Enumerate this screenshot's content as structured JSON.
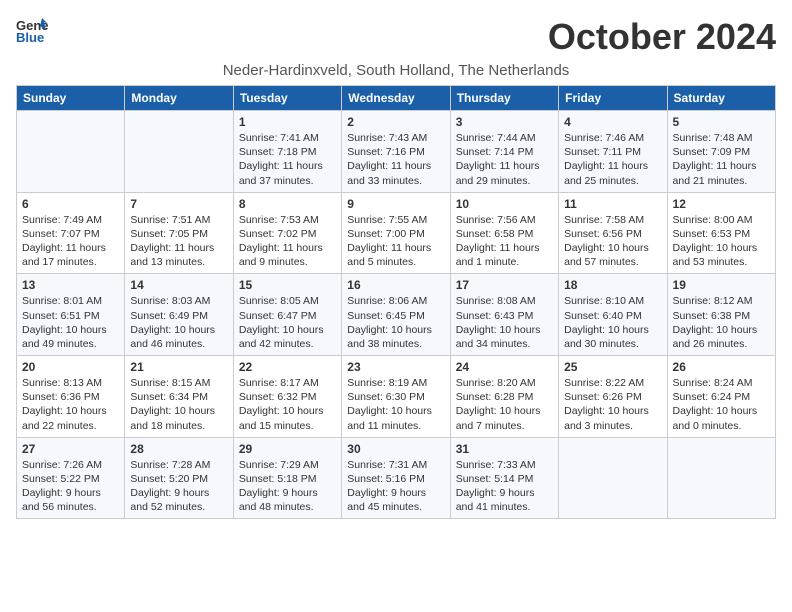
{
  "header": {
    "logo": {
      "general": "General",
      "blue": "Blue"
    },
    "title": "October 2024",
    "location": "Neder-Hardinxveld, South Holland, The Netherlands"
  },
  "weekdays": [
    "Sunday",
    "Monday",
    "Tuesday",
    "Wednesday",
    "Thursday",
    "Friday",
    "Saturday"
  ],
  "weeks": [
    [
      {
        "day": "",
        "detail": ""
      },
      {
        "day": "",
        "detail": ""
      },
      {
        "day": "1",
        "detail": "Sunrise: 7:41 AM\nSunset: 7:18 PM\nDaylight: 11 hours and 37 minutes."
      },
      {
        "day": "2",
        "detail": "Sunrise: 7:43 AM\nSunset: 7:16 PM\nDaylight: 11 hours and 33 minutes."
      },
      {
        "day": "3",
        "detail": "Sunrise: 7:44 AM\nSunset: 7:14 PM\nDaylight: 11 hours and 29 minutes."
      },
      {
        "day": "4",
        "detail": "Sunrise: 7:46 AM\nSunset: 7:11 PM\nDaylight: 11 hours and 25 minutes."
      },
      {
        "day": "5",
        "detail": "Sunrise: 7:48 AM\nSunset: 7:09 PM\nDaylight: 11 hours and 21 minutes."
      }
    ],
    [
      {
        "day": "6",
        "detail": "Sunrise: 7:49 AM\nSunset: 7:07 PM\nDaylight: 11 hours and 17 minutes."
      },
      {
        "day": "7",
        "detail": "Sunrise: 7:51 AM\nSunset: 7:05 PM\nDaylight: 11 hours and 13 minutes."
      },
      {
        "day": "8",
        "detail": "Sunrise: 7:53 AM\nSunset: 7:02 PM\nDaylight: 11 hours and 9 minutes."
      },
      {
        "day": "9",
        "detail": "Sunrise: 7:55 AM\nSunset: 7:00 PM\nDaylight: 11 hours and 5 minutes."
      },
      {
        "day": "10",
        "detail": "Sunrise: 7:56 AM\nSunset: 6:58 PM\nDaylight: 11 hours and 1 minute."
      },
      {
        "day": "11",
        "detail": "Sunrise: 7:58 AM\nSunset: 6:56 PM\nDaylight: 10 hours and 57 minutes."
      },
      {
        "day": "12",
        "detail": "Sunrise: 8:00 AM\nSunset: 6:53 PM\nDaylight: 10 hours and 53 minutes."
      }
    ],
    [
      {
        "day": "13",
        "detail": "Sunrise: 8:01 AM\nSunset: 6:51 PM\nDaylight: 10 hours and 49 minutes."
      },
      {
        "day": "14",
        "detail": "Sunrise: 8:03 AM\nSunset: 6:49 PM\nDaylight: 10 hours and 46 minutes."
      },
      {
        "day": "15",
        "detail": "Sunrise: 8:05 AM\nSunset: 6:47 PM\nDaylight: 10 hours and 42 minutes."
      },
      {
        "day": "16",
        "detail": "Sunrise: 8:06 AM\nSunset: 6:45 PM\nDaylight: 10 hours and 38 minutes."
      },
      {
        "day": "17",
        "detail": "Sunrise: 8:08 AM\nSunset: 6:43 PM\nDaylight: 10 hours and 34 minutes."
      },
      {
        "day": "18",
        "detail": "Sunrise: 8:10 AM\nSunset: 6:40 PM\nDaylight: 10 hours and 30 minutes."
      },
      {
        "day": "19",
        "detail": "Sunrise: 8:12 AM\nSunset: 6:38 PM\nDaylight: 10 hours and 26 minutes."
      }
    ],
    [
      {
        "day": "20",
        "detail": "Sunrise: 8:13 AM\nSunset: 6:36 PM\nDaylight: 10 hours and 22 minutes."
      },
      {
        "day": "21",
        "detail": "Sunrise: 8:15 AM\nSunset: 6:34 PM\nDaylight: 10 hours and 18 minutes."
      },
      {
        "day": "22",
        "detail": "Sunrise: 8:17 AM\nSunset: 6:32 PM\nDaylight: 10 hours and 15 minutes."
      },
      {
        "day": "23",
        "detail": "Sunrise: 8:19 AM\nSunset: 6:30 PM\nDaylight: 10 hours and 11 minutes."
      },
      {
        "day": "24",
        "detail": "Sunrise: 8:20 AM\nSunset: 6:28 PM\nDaylight: 10 hours and 7 minutes."
      },
      {
        "day": "25",
        "detail": "Sunrise: 8:22 AM\nSunset: 6:26 PM\nDaylight: 10 hours and 3 minutes."
      },
      {
        "day": "26",
        "detail": "Sunrise: 8:24 AM\nSunset: 6:24 PM\nDaylight: 10 hours and 0 minutes."
      }
    ],
    [
      {
        "day": "27",
        "detail": "Sunrise: 7:26 AM\nSunset: 5:22 PM\nDaylight: 9 hours and 56 minutes."
      },
      {
        "day": "28",
        "detail": "Sunrise: 7:28 AM\nSunset: 5:20 PM\nDaylight: 9 hours and 52 minutes."
      },
      {
        "day": "29",
        "detail": "Sunrise: 7:29 AM\nSunset: 5:18 PM\nDaylight: 9 hours and 48 minutes."
      },
      {
        "day": "30",
        "detail": "Sunrise: 7:31 AM\nSunset: 5:16 PM\nDaylight: 9 hours and 45 minutes."
      },
      {
        "day": "31",
        "detail": "Sunrise: 7:33 AM\nSunset: 5:14 PM\nDaylight: 9 hours and 41 minutes."
      },
      {
        "day": "",
        "detail": ""
      },
      {
        "day": "",
        "detail": ""
      }
    ]
  ]
}
